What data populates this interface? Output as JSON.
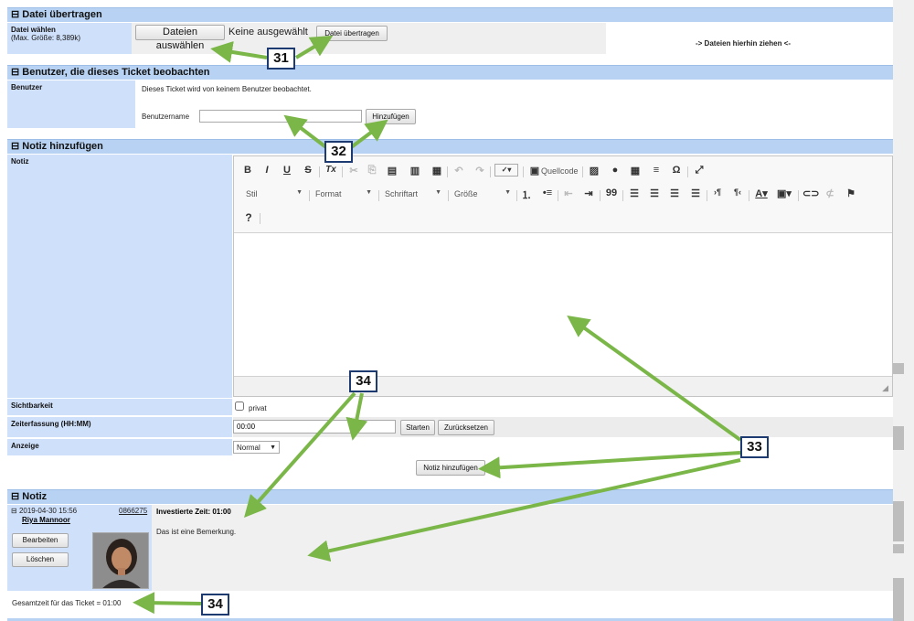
{
  "upload": {
    "header": "Datei übertragen",
    "label": "Datei wählen",
    "sublabel": "(Max. Größe: 8,389k)",
    "choose_label": "Dateien auswählen",
    "no_file": "Keine ausgewählt",
    "transfer_label": "Datei übertragen",
    "dropzone": "-> Dateien hierhin ziehen <-"
  },
  "watchers": {
    "header": "Benutzer, die dieses Ticket beobachten",
    "label": "Benutzer",
    "info": "Dieses Ticket wird von keinem Benutzer beobachtet.",
    "username_label": "Benutzername",
    "username_value": "",
    "add_label": "Hinzufügen"
  },
  "add_note": {
    "header": "Notiz hinzufügen",
    "label": "Notiz",
    "toolbar": {
      "bold": "B",
      "italic": "I",
      "underline": "U",
      "strike": "S",
      "remove_format": "Tx",
      "source_label": "Quellcode",
      "style_combo": "Stil",
      "format_combo": "Format",
      "font_combo": "Schriftart",
      "size_combo": "Größe",
      "help": "?",
      "omega": "Ω",
      "quote": "99"
    },
    "visibility_label": "Sichtbarkeit",
    "private_label": "privat",
    "time_label": "Zeiterfassung (HH:MM)",
    "time_value": "00:00",
    "start_label": "Starten",
    "reset_label": "Zurücksetzen",
    "display_label": "Anzeige",
    "display_value": "Normal",
    "submit_label": "Notiz hinzufügen"
  },
  "note": {
    "header": "Notiz",
    "datetime": "2019-04-30 15:56",
    "ticket_no": "0866275",
    "author": "Riya Mannoor",
    "time_invested": "Investierte Zeit: 01:00",
    "text": "Das ist eine Bemerkung.",
    "edit_label": "Bearbeiten",
    "delete_label": "Löschen",
    "total": "Gesamtzeit für das Ticket = 01:00"
  },
  "annotations": {
    "b31": "31",
    "b32": "32",
    "b33": "33",
    "b34a": "34",
    "b34b": "34",
    "arrow_color": "#7ab648"
  }
}
